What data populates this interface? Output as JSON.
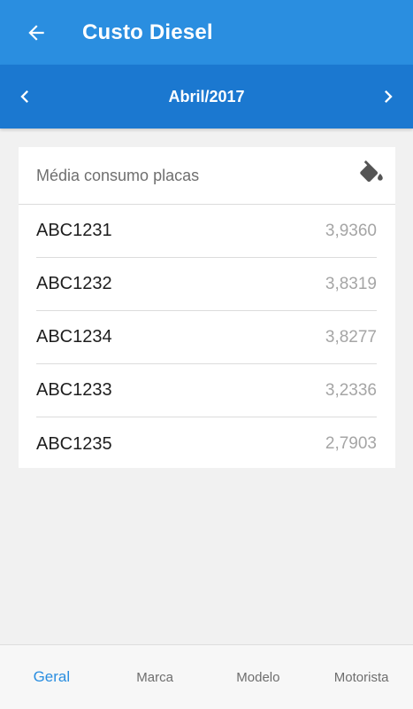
{
  "appbar": {
    "title": "Custo Diesel",
    "back_icon": "arrow-left-icon",
    "color": "#2a8ee0"
  },
  "month_selector": {
    "label": "Abril/2017",
    "prev_icon": "chevron-left-icon",
    "next_icon": "chevron-right-icon",
    "color": "#1b78d0"
  },
  "card": {
    "header": "Média consumo placas",
    "header_icon": "fuel-paint-bucket-icon",
    "rows": [
      {
        "plate": "ABC1231",
        "value": "3,9360"
      },
      {
        "plate": "ABC1232",
        "value": "3,8319"
      },
      {
        "plate": "ABC1234",
        "value": "3,8277"
      },
      {
        "plate": "ABC1233",
        "value": "3,2336"
      },
      {
        "plate": "ABC1235",
        "value": "2,7903"
      }
    ]
  },
  "bottom_nav": {
    "items": [
      {
        "label": "Geral",
        "active": true
      },
      {
        "label": "Marca",
        "active": false
      },
      {
        "label": "Modelo",
        "active": false
      },
      {
        "label": "Motorista",
        "active": false
      }
    ],
    "active_color": "#2a8ee0"
  }
}
